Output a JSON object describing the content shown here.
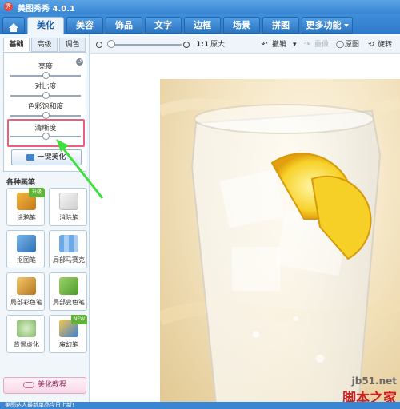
{
  "app": {
    "logo_glyph": "秀",
    "title": "美图秀秀 4.0.1"
  },
  "tabs": [
    {
      "label": "",
      "icon": "home-icon"
    },
    {
      "label": "美化",
      "active": true
    },
    {
      "label": "美容"
    },
    {
      "label": "饰品"
    },
    {
      "label": "文字"
    },
    {
      "label": "边框"
    },
    {
      "label": "场景"
    },
    {
      "label": "拼图"
    },
    {
      "label": "更多功能"
    }
  ],
  "left_panel": {
    "subtabs": [
      "基础",
      "高级",
      "调色"
    ],
    "adjustments": [
      {
        "label": "亮度",
        "value": 0.5
      },
      {
        "label": "对比度",
        "value": 0.5
      },
      {
        "label": "色彩饱和度",
        "value": 0.5
      },
      {
        "label": "清晰度",
        "value": 0.5
      }
    ],
    "one_click_label": "一键美化",
    "tools_title": "各种画笔",
    "tools": [
      {
        "label": "涂鸦笔",
        "icon": "doodle-pen-icon",
        "badge": "升级"
      },
      {
        "label": "消除笔",
        "icon": "eraser-pen-icon"
      },
      {
        "label": "抠图笔",
        "icon": "cutout-pen-icon"
      },
      {
        "label": "局部马赛克",
        "icon": "mosaic-icon"
      },
      {
        "label": "局部彩色笔",
        "icon": "color-pen-icon"
      },
      {
        "label": "局部变色笔",
        "icon": "recolor-pen-icon"
      },
      {
        "label": "背景虚化",
        "icon": "background-blur-icon"
      },
      {
        "label": "魔幻笔",
        "icon": "magic-pen-icon",
        "badge": "NEW"
      }
    ],
    "tutorial_label": "美化教程"
  },
  "toolbar": {
    "ratio": "1:1",
    "original_size": "原大",
    "undo": "撤销",
    "redo": "重做",
    "original": "原图",
    "rotate": "旋转"
  },
  "status": {
    "text": "美图达人最新单品今日上新!"
  },
  "watermark": {
    "site": "jb51.net",
    "name": "脚本之家"
  },
  "colors": {
    "accent": "#3a86d3",
    "highlight": "#e9607f",
    "arrow": "#3de03d"
  }
}
